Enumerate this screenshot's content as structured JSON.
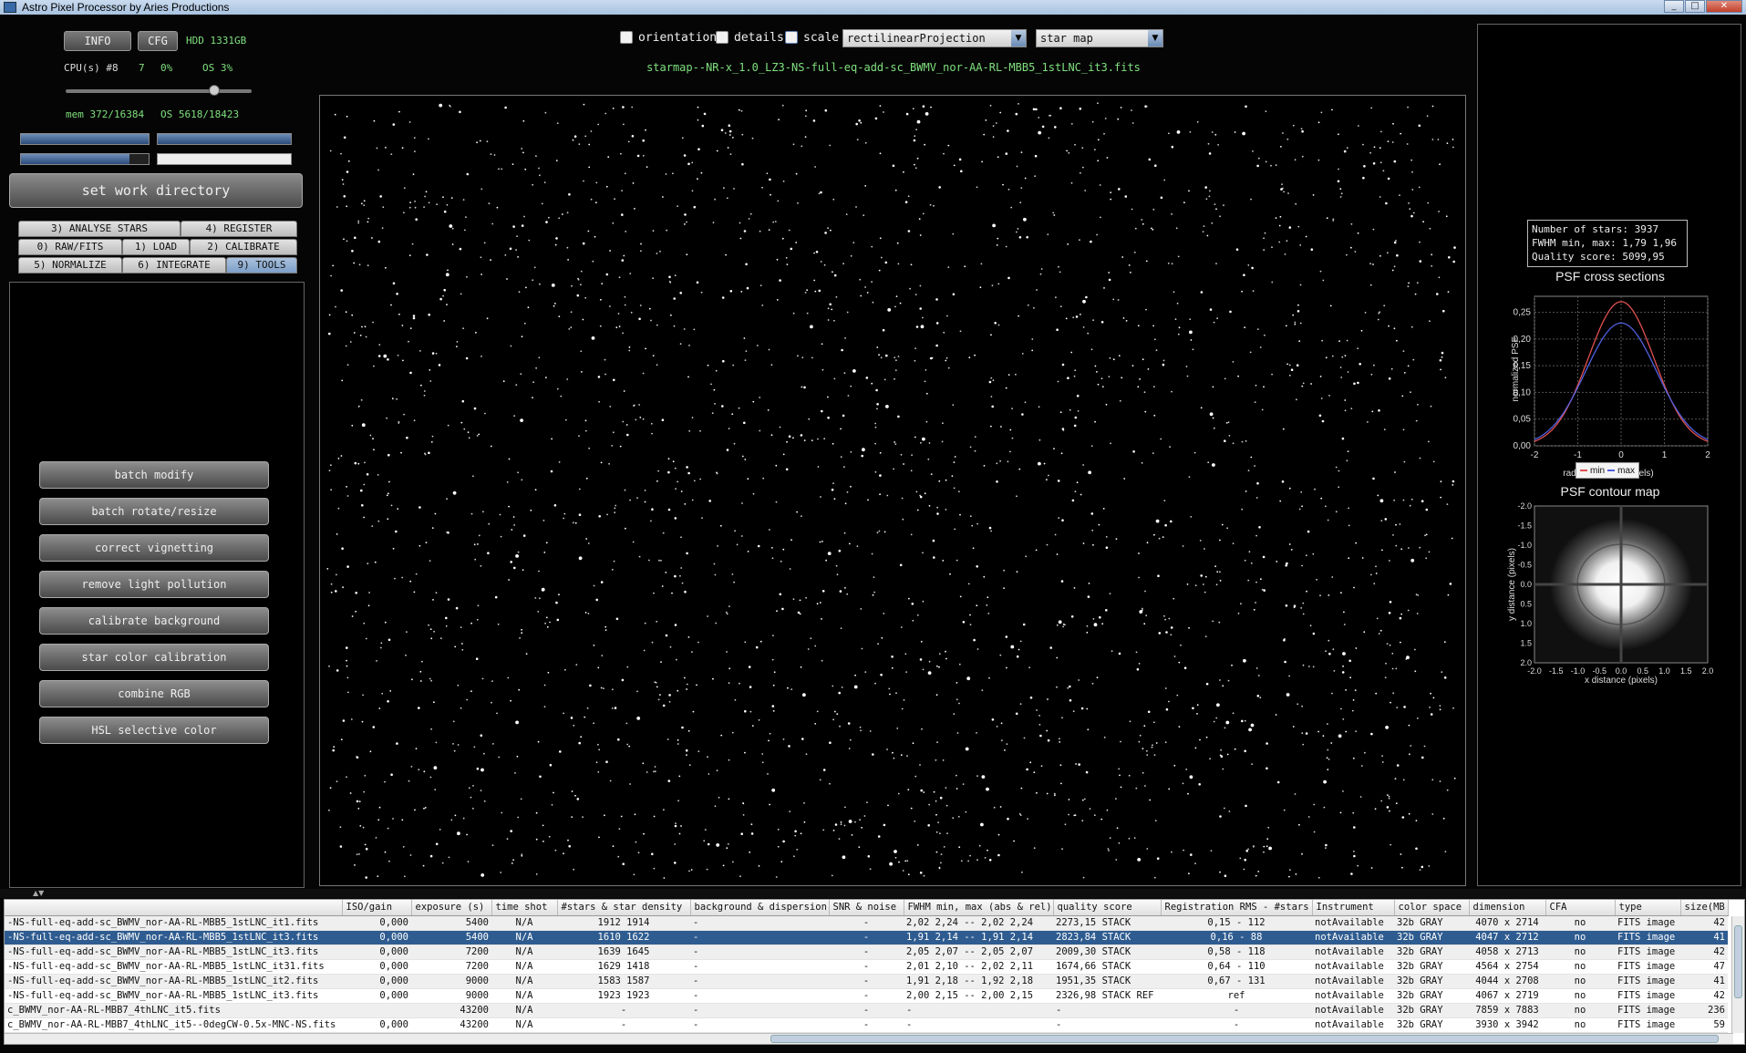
{
  "window": {
    "title": "Astro Pixel Processor by  Aries Productions",
    "controls": [
      "_",
      "□",
      "✕"
    ]
  },
  "system": {
    "info_label": "INFO",
    "cfg_label": "CFG",
    "hdd": "HDD 1331GB",
    "cpu_label": "CPU(s) #8",
    "cpu_threads": "7",
    "cpu_usage": "0%",
    "os_usage": "OS 3%",
    "thread_slider_fraction": 0.8,
    "mem": "mem 372/16384",
    "os_mem": "OS 5618/18423",
    "progress_bars": [
      1.0,
      1.0,
      0.85,
      0.0
    ]
  },
  "workdir_button": "set work directory",
  "tabs": [
    {
      "label": "3) ANALYSE STARS"
    },
    {
      "label": "4) REGISTER"
    },
    {
      "label": "0) RAW/FITS"
    },
    {
      "label": "1) LOAD"
    },
    {
      "label": "2) CALIBRATE"
    },
    {
      "label": "5) NORMALIZE"
    },
    {
      "label": "6) INTEGRATE"
    },
    {
      "label": "9) TOOLS",
      "active": true
    }
  ],
  "tools": [
    "batch modify",
    "batch rotate/resize",
    "correct vignetting",
    "remove light pollution",
    "calibrate background",
    "star color calibration",
    "combine RGB",
    "HSL selective color"
  ],
  "view_options": {
    "orientation": "orientation",
    "details": "details",
    "scale": "scale",
    "projection": "rectilinearProjection",
    "view_mode": "star map"
  },
  "image_filename": "starmap--NR-x_1.0_LZ3-NS-full-eq-add-sc_BWMV_nor-AA-RL-MBB5_1stLNC_it3.fits",
  "star_stats": {
    "stars": "Number of stars: 3937",
    "fwhm": "FWHM min, max: 1,79 1,96",
    "quality": "Quality score: 5099,95"
  },
  "psf_cross": {
    "title": "PSF cross sections",
    "xlabel": "radial distance (pixels)",
    "ylabel": "normalized PSF",
    "x_ticks": [
      "-2",
      "-1",
      "0",
      "1",
      "2"
    ],
    "y_ticks": [
      "0,00",
      "0,05",
      "0,10",
      "0,15",
      "0,20",
      "0,25"
    ],
    "legend_min": "min",
    "legend_max": "max",
    "min_peak": 0.27,
    "max_peak": 0.23,
    "colors": {
      "min": "#e05050",
      "max": "#5060e0"
    }
  },
  "psf_contour": {
    "title": "PSF contour map",
    "xlabel": "x distance (pixels)",
    "ylabel": "y distance (pixels)",
    "ticks": [
      "-2.0",
      "-1.5",
      "-1.0",
      "-0.5",
      "0.0",
      "0.5",
      "1.0",
      "1.5",
      "2.0"
    ]
  },
  "table": {
    "headers": [
      "",
      "ISO/gain",
      "exposure (s)",
      "time shot",
      "#stars & star density",
      "background & dispersion",
      "SNR & noise",
      "FWHM min, max (abs & rel)",
      "quality score",
      "Registration RMS - #stars",
      "Instrument",
      "color space",
      "dimension",
      "CFA",
      "type",
      "size(MB"
    ],
    "rows": [
      [
        "-NS-full-eq-add-sc_BWMV_nor-AA-RL-MBB5_1stLNC_it1.fits",
        "0,000",
        "5400",
        "N/A",
        "1912 1914",
        "-",
        "-",
        "2,02 2,24 -- 2,02 2,24",
        "2273,15 STACK",
        "0,15 - 112",
        "notAvailable",
        "32b GRAY",
        "4070 x 2714",
        "no",
        "FITS image",
        "42"
      ],
      [
        "-NS-full-eq-add-sc_BWMV_nor-AA-RL-MBB5_1stLNC_it3.fits",
        "0,000",
        "5400",
        "N/A",
        "1610 1622",
        "-",
        "-",
        "1,91 2,14 -- 1,91 2,14",
        "2823,84 STACK",
        "0,16 - 88",
        "notAvailable",
        "32b GRAY",
        "4047 x 2712",
        "no",
        "FITS image",
        "41"
      ],
      [
        "-NS-full-eq-add-sc_BWMV_nor-AA-RL-MBB5_1stLNC_it3.fits",
        "0,000",
        "7200",
        "N/A",
        "1639 1645",
        "-",
        "-",
        "2,05 2,07 -- 2,05 2,07",
        "2009,30 STACK",
        "0,58 - 118",
        "notAvailable",
        "32b GRAY",
        "4058 x 2713",
        "no",
        "FITS image",
        "42"
      ],
      [
        "-NS-full-eq-add-sc_BWMV_nor-AA-RL-MBB5_1stLNC_it31.fits",
        "0,000",
        "7200",
        "N/A",
        "1629 1418",
        "-",
        "-",
        "2,01 2,10 -- 2,02 2,11",
        "1674,66 STACK",
        "0,64 - 110",
        "notAvailable",
        "32b GRAY",
        "4564 x 2754",
        "no",
        "FITS image",
        "47"
      ],
      [
        "-NS-full-eq-add-sc_BWMV_nor-AA-RL-MBB5_1stLNC_it2.fits",
        "0,000",
        "9000",
        "N/A",
        "1583 1587",
        "-",
        "-",
        "1,91 2,18 -- 1,92 2,18",
        "1951,35 STACK",
        "0,67 - 131",
        "notAvailable",
        "32b GRAY",
        "4044 x 2708",
        "no",
        "FITS image",
        "41"
      ],
      [
        "-NS-full-eq-add-sc_BWMV_nor-AA-RL-MBB5_1stLNC_it3.fits",
        "0,000",
        "9000",
        "N/A",
        "1923 1923",
        "-",
        "-",
        "2,00 2,15 -- 2,00 2,15",
        "2326,98 STACK REF",
        "ref",
        "notAvailable",
        "32b GRAY",
        "4067 x 2719",
        "no",
        "FITS image",
        "42"
      ],
      [
        "c_BWMV_nor-AA-RL-MBB7_4thLNC_it5.fits",
        "",
        "43200",
        "N/A",
        "-",
        "-",
        "-",
        "-",
        "-",
        "-",
        "notAvailable",
        "32b GRAY",
        "7859 x 7883",
        "no",
        "FITS image",
        "236"
      ],
      [
        "c_BWMV_nor-AA-RL-MBB7_4thLNC_it5--0degCW-0.5x-MNC-NS.fits",
        "0,000",
        "43200",
        "N/A",
        "-",
        "-",
        "-",
        "-",
        "-",
        "-",
        "notAvailable",
        "32b GRAY",
        "3930 x 3942",
        "no",
        "FITS image",
        "59"
      ]
    ],
    "selected_row": 1
  }
}
